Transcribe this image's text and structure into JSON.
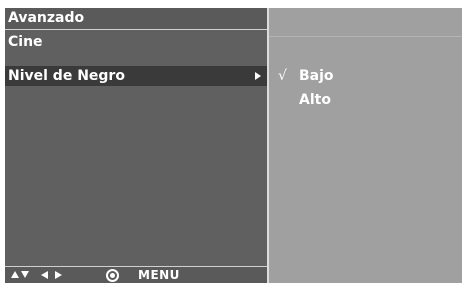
{
  "header": {
    "title": "Avanzado"
  },
  "menu": {
    "items": [
      {
        "label": "Cine",
        "selected": false
      },
      {
        "label": "Nivel de Negro",
        "selected": true,
        "has_submenu": true
      }
    ]
  },
  "submenu": {
    "options": [
      {
        "label": "Bajo",
        "checked": true,
        "check_mark": "√"
      },
      {
        "label": "Alto",
        "checked": false,
        "check_mark": ""
      }
    ]
  },
  "footer": {
    "nav_icons": [
      "up-arrow-icon",
      "down-arrow-icon",
      "left-arrow-icon",
      "right-arrow-icon",
      "ok-icon"
    ],
    "menu_label": "MENU"
  },
  "colors": {
    "panel": "#606060",
    "selected_row": "#3a3a3a",
    "submenu_panel": "#a0a0a0",
    "text": "#ffffff"
  }
}
